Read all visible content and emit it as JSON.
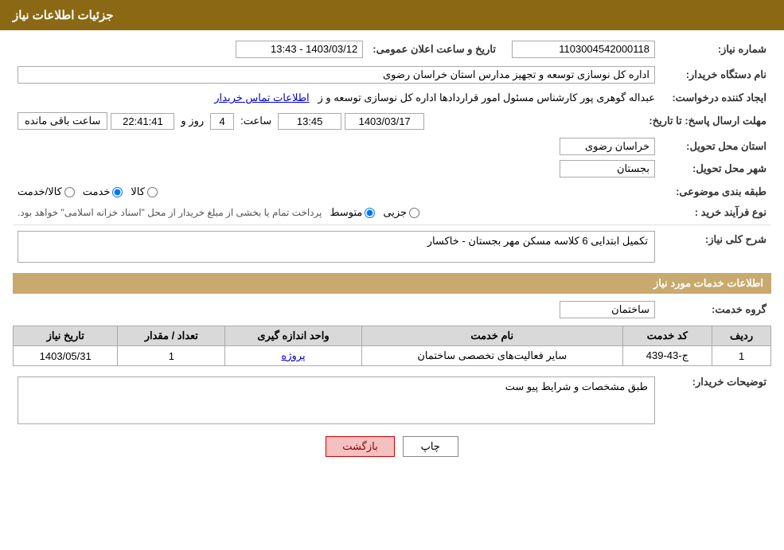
{
  "header": {
    "title": "جزئیات اطلاعات نیاز"
  },
  "fields": {
    "need_number_label": "شماره نیاز:",
    "need_number_value": "1103004542000118",
    "buyer_org_label": "نام دستگاه خریدار:",
    "buyer_org_value": "اداره کل نوسازی  توسعه و تجهیز مدارس استان خراسان رضوی",
    "creator_label": "ایجاد کننده درخواست:",
    "creator_value": "عبداله گوهری پور کارشناس مسئول امور قراردادها  اداره کل نوسازی  توسعه و ز",
    "creator_link": "اطلاعات تماس خریدار",
    "deadline_label": "مهلت ارسال پاسخ: تا تاریخ:",
    "deadline_date": "1403/03/17",
    "deadline_time_label": "ساعت:",
    "deadline_time": "13:45",
    "deadline_days_label": "روز و",
    "deadline_days": "4",
    "deadline_countdown": "22:41:41",
    "deadline_remaining": "ساعت باقی مانده",
    "province_label": "استان محل تحویل:",
    "province_value": "خراسان رضوی",
    "city_label": "شهر محل تحویل:",
    "city_value": "بجستان",
    "category_label": "طبقه بندی موضوعی:",
    "category_options": [
      {
        "label": "کالا",
        "selected": false
      },
      {
        "label": "خدمت",
        "selected": true
      },
      {
        "label": "کالا/خدمت",
        "selected": false
      }
    ],
    "purchase_type_label": "نوع فرآیند خرید :",
    "purchase_type_options": [
      {
        "label": "جزیی",
        "selected": false
      },
      {
        "label": "متوسط",
        "selected": true
      }
    ],
    "purchase_type_note": "پرداخت تمام یا بخشی از مبلغ خریدار از محل \"اسناد خزانه اسلامی\" خواهد بود.",
    "general_desc_label": "شرح کلی نیاز:",
    "general_desc_value": "تکمیل ابتدایی 6 کلاسه مسکن مهر بجستان - خاکسار",
    "services_section_label": "اطلاعات خدمات مورد نیاز",
    "service_group_label": "گروه خدمت:",
    "service_group_value": "ساختمان",
    "table": {
      "headers": [
        "ردیف",
        "کد خدمت",
        "نام خدمت",
        "واحد اندازه گیری",
        "تعداد / مقدار",
        "تاریخ نیاز"
      ],
      "rows": [
        {
          "row": "1",
          "code": "ج-43-439",
          "name": "سایر فعالیت‌های تخصصی ساختمان",
          "unit": "پروژه",
          "quantity": "1",
          "date": "1403/05/31"
        }
      ]
    },
    "buyer_notes_label": "توضیحات خریدار:",
    "buyer_notes_value": "طبق مشخصات و شرایط پیو ست",
    "announce_label": "تاریخ و ساعت اعلان عمومی:",
    "announce_value": "1403/03/12 - 13:43"
  },
  "buttons": {
    "print": "چاپ",
    "back": "بازگشت"
  }
}
